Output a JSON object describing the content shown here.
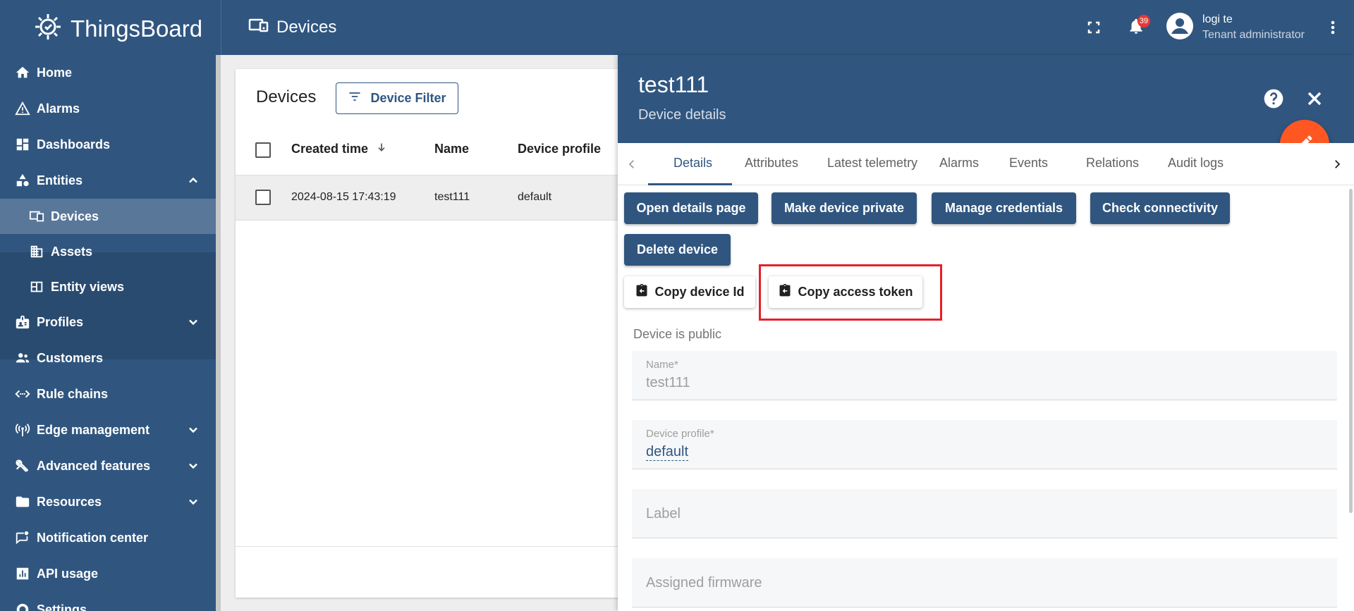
{
  "header": {
    "logo_text": "ThingsBoard",
    "page_title": "Devices",
    "notification_count": "39",
    "user_name": "logi te",
    "user_role": "Tenant administrator"
  },
  "sidebar": {
    "items": [
      {
        "label": "Home",
        "icon": "home-icon"
      },
      {
        "label": "Alarms",
        "icon": "warning-icon"
      },
      {
        "label": "Dashboards",
        "icon": "dashboard-icon"
      },
      {
        "label": "Entities",
        "icon": "entities-icon",
        "expanded": true
      },
      {
        "label": "Devices",
        "icon": "devices-icon",
        "active": true
      },
      {
        "label": "Assets",
        "icon": "assets-icon"
      },
      {
        "label": "Entity views",
        "icon": "entity-views-icon"
      },
      {
        "label": "Profiles",
        "icon": "badge-icon"
      },
      {
        "label": "Customers",
        "icon": "customers-icon"
      },
      {
        "label": "Rule chains",
        "icon": "rule-chains-icon"
      },
      {
        "label": "Edge management",
        "icon": "edge-icon"
      },
      {
        "label": "Advanced features",
        "icon": "tools-icon"
      },
      {
        "label": "Resources",
        "icon": "folder-icon"
      },
      {
        "label": "Notification center",
        "icon": "notification-center-icon"
      },
      {
        "label": "API usage",
        "icon": "api-usage-icon"
      },
      {
        "label": "Settings",
        "icon": "gear-icon"
      }
    ]
  },
  "list": {
    "title": "Devices",
    "filter_label": "Device Filter",
    "columns": [
      "Created time",
      "Name",
      "Device profile"
    ],
    "rows": [
      {
        "created": "2024-08-15 17:43:19",
        "name": "test111",
        "profile": "default"
      }
    ]
  },
  "details": {
    "title": "test111",
    "subtitle": "Device details",
    "tabs": [
      "Details",
      "Attributes",
      "Latest telemetry",
      "Alarms",
      "Events",
      "Relations",
      "Audit logs"
    ],
    "active_tab": "Details",
    "buttons": {
      "open_details": "Open details page",
      "make_private": "Make device private",
      "manage_credentials": "Manage credentials",
      "check_connectivity": "Check connectivity",
      "delete_device": "Delete device",
      "copy_device_id": "Copy device Id",
      "copy_access_token": "Copy access token"
    },
    "public_status": "Device is public",
    "fields": {
      "name_label": "Name*",
      "name_value": "test111",
      "profile_label": "Device profile*",
      "profile_value": "default",
      "label_placeholder": "Label",
      "firmware_placeholder": "Assigned firmware"
    }
  },
  "colors": {
    "primary": "#305680",
    "accent_fab": "#ff5722",
    "highlight": "#e5202a",
    "badge": "#e53935"
  }
}
